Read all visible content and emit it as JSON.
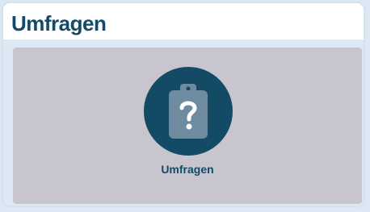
{
  "header": {
    "title": "Umfragen"
  },
  "tile": {
    "label": "Umfragen",
    "icon": "clipboard-question-icon"
  },
  "colors": {
    "accent": "#134a66",
    "tile_background": "#c9c5ce",
    "page_background": "#dce8f3",
    "icon_fill": "#6f8ba0"
  }
}
